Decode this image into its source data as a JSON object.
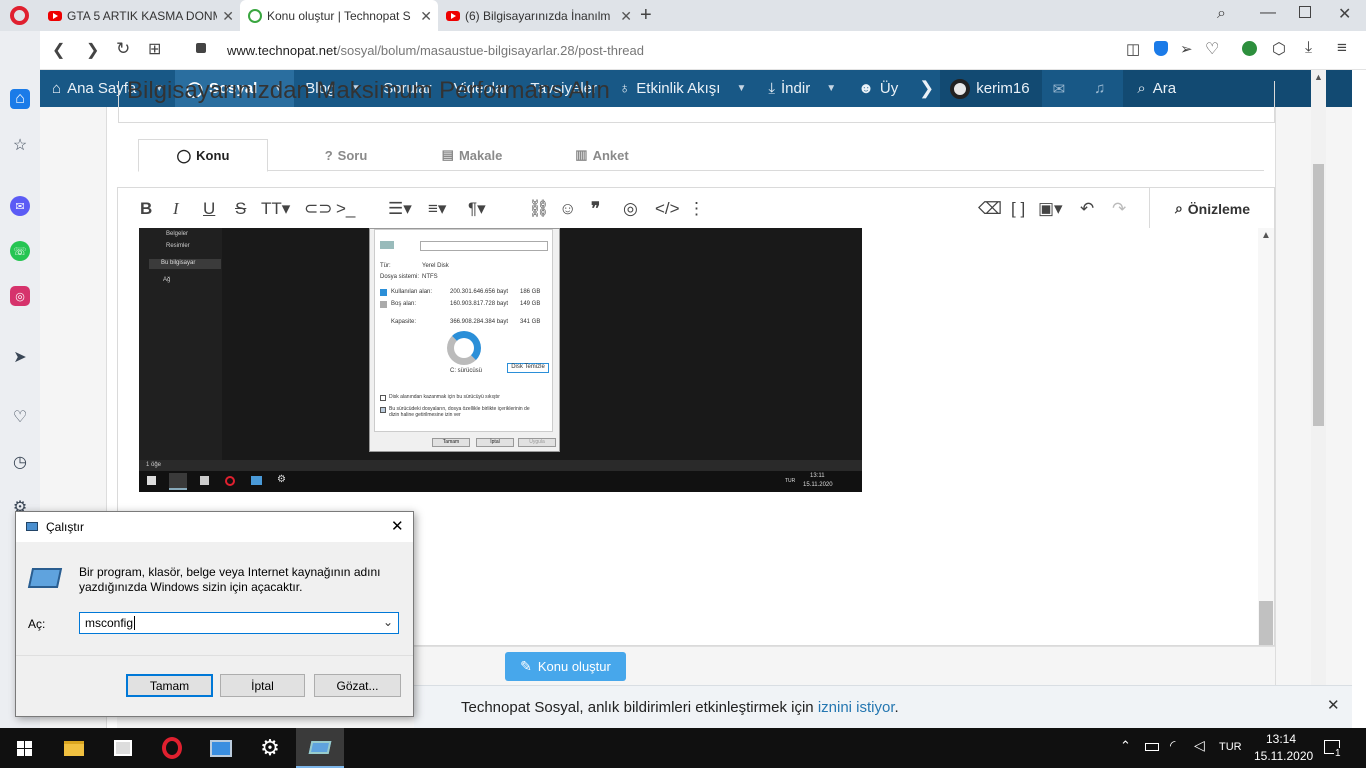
{
  "browser": {
    "tabs": [
      {
        "title": "GTA 5 ARTIK KASMA DONM",
        "icon": "youtube-icon"
      },
      {
        "title": "Konu oluştur | Technopat S",
        "icon": "technopat-icon"
      },
      {
        "title": "(6) Bilgisayarınızda İnanılm",
        "icon": "youtube-icon"
      }
    ],
    "url_host": "www.technopat.net",
    "url_path": "/sosyal/bolum/masaustue-bilgisayarlar.28/post-thread"
  },
  "site_nav": {
    "items": [
      "Ana Sayfa",
      "Sosyal",
      "Blog",
      "Sorular",
      "Videolar",
      "Tavsiyeler",
      "Etkinlik Akışı",
      "İndir",
      "Üy"
    ],
    "user": "kerim16",
    "search": "Ara",
    "brand_color": "#185886"
  },
  "form": {
    "title_partial": "Bilgisayarınızdan Maksimum Performans Alın",
    "tabs": [
      "Konu",
      "Soru",
      "Makale",
      "Anket"
    ],
    "preview": "Önizleme",
    "submit": "Konu oluştur"
  },
  "embedded_screenshot": {
    "side_items": [
      "Belgeler",
      "Resimler",
      "Bu bilgisayar",
      "Ağ"
    ],
    "props": {
      "type_label": "Tür:",
      "type_value": "Yerel Disk",
      "fs_label": "Dosya sistemi:",
      "fs_value": "NTFS",
      "used_label": "Kullanılan alan:",
      "used_bytes": "200.301.646.656 bayt",
      "used_gb": "186 GB",
      "free_label": "Boş alan:",
      "free_bytes": "160.903.817.728 bayt",
      "free_gb": "149 GB",
      "cap_label": "Kapasite:",
      "cap_bytes": "366.908.284.384 bayt",
      "cap_gb": "341 GB",
      "drive": "C: sürücüsü",
      "cleanup": "Disk Temizle",
      "chk1": "Disk alanından kazanmak için bu sürücüyü sıkıştır",
      "chk2": "Bu sürücüdeki dosyaların, dosya özellikle birlikte içeriklerinin de dizin haline getirilmesine izin ver",
      "ok": "Tamam",
      "cancel": "İptal",
      "apply": "Uygula"
    },
    "status": "1 öğe",
    "tray_lang": "TUR",
    "time": "13:11",
    "date": "15.11.2020"
  },
  "run_dialog": {
    "title": "Çalıştır",
    "description_line1": "Bir program, klasör, belge veya Internet kaynağının adını",
    "description_line2": "yazdığınızda Windows sizin için açacaktır.",
    "open_label": "Aç:",
    "input_value": "msconfig",
    "ok": "Tamam",
    "cancel": "İptal",
    "browse": "Gözat..."
  },
  "notification": {
    "text": "Technopat Sosyal, anlık bildirimleri etkinleştirmek için",
    "link1": "iznini",
    "link2": "istiyor",
    "end": "."
  },
  "taskbar": {
    "lang": "TUR",
    "time": "13:14",
    "date": "15.11.2020",
    "notif_count": "1"
  }
}
